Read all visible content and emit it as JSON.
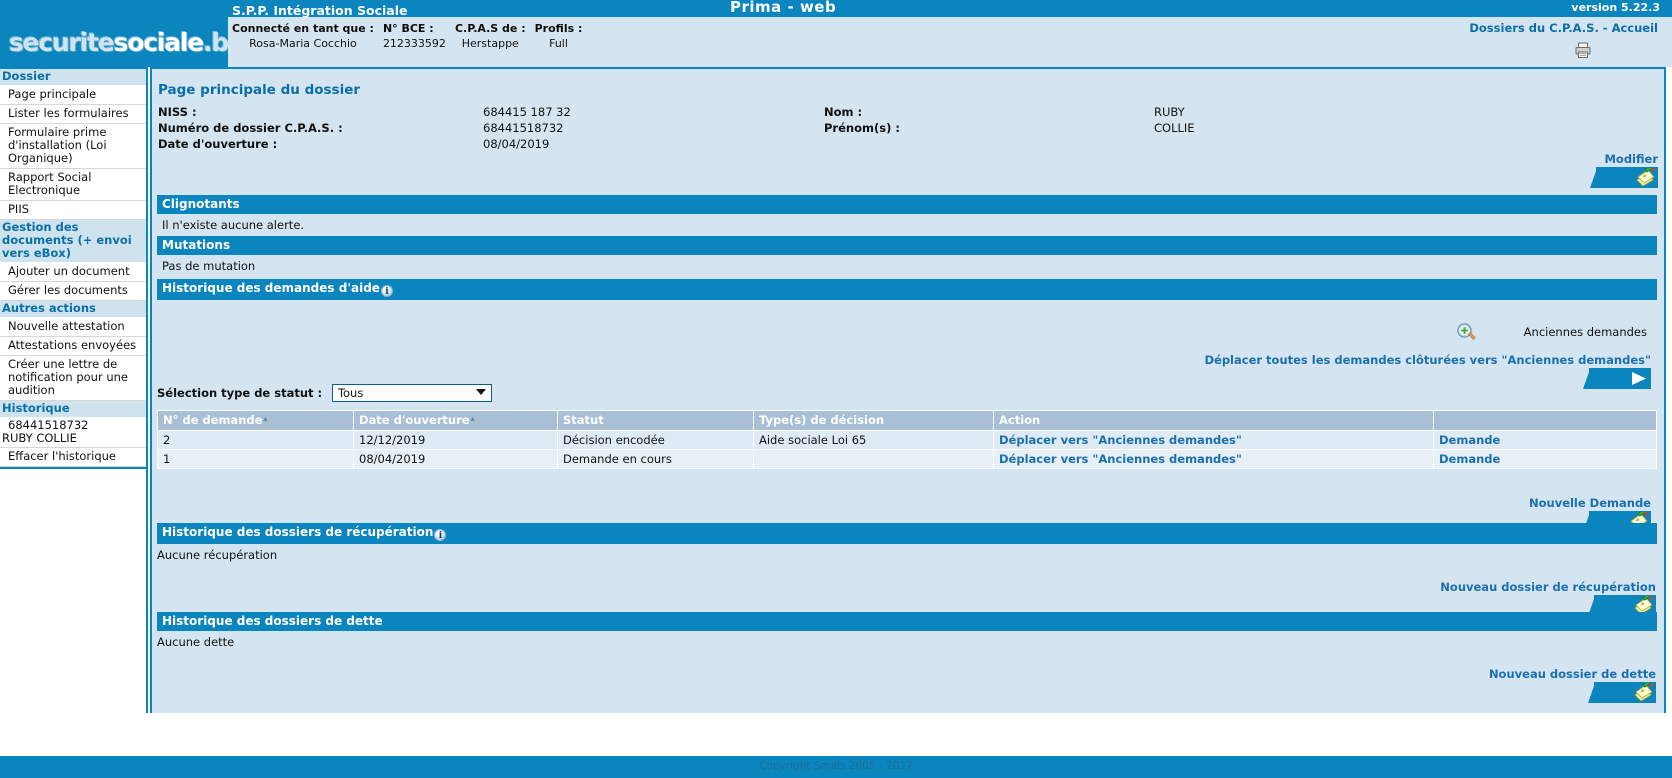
{
  "topbar": {
    "app_title": "Prima - web",
    "version": "version 5.22.3"
  },
  "header": {
    "logo_text_part1": "securite",
    "logo_text_part2": "sociale",
    "logo_text_part3": ".be",
    "spp_title": "S.P.P. Intégration Sociale",
    "fields": [
      {
        "label": "Connecté en tant que :",
        "value": "Rosa-Maria Cocchio"
      },
      {
        "label": "N° BCE :",
        "value": "212333592"
      },
      {
        "label": "C.P.A.S de :",
        "value": "Herstappe"
      },
      {
        "label": "Profils :",
        "value": "Full"
      }
    ],
    "links": "Dossiers du C.P.A.S. - Accueil",
    "printer_icon": "printer-icon"
  },
  "sidebar": {
    "groups": [
      {
        "title": "Dossier",
        "items": [
          "Page principale",
          "Lister les formulaires",
          "Formulaire prime d'installation (Loi Organique)",
          "Rapport Social Electronique",
          "PIIS"
        ]
      },
      {
        "title": "Gestion des documents (+ envoi vers eBox)",
        "items": [
          "Ajouter un document",
          "Gérer les documents"
        ]
      },
      {
        "title": "Autres actions",
        "items": [
          "Nouvelle attestation",
          "Attestations envoyées",
          "Créer une lettre de notification pour une audition"
        ]
      }
    ],
    "history": {
      "title": "Historique",
      "number": "68441518732",
      "name": "RUBY COLLIE",
      "clear_label": "Effacer l'historique"
    }
  },
  "main": {
    "page_title": "Page principale du dossier",
    "dossier": {
      "left": [
        {
          "label": "NISS :",
          "value": "684415 187 32"
        },
        {
          "label": "Numéro de dossier C.P.A.S. :",
          "value": "68441518732"
        },
        {
          "label": "Date d'ouverture :",
          "value": "08/04/2019"
        }
      ],
      "right": [
        {
          "label": "Nom :",
          "value": "RUBY"
        },
        {
          "label": "Prénom(s) :",
          "value": "COLLIE"
        }
      ],
      "modify_label": "Modifier",
      "modify_icon": "edit-pencil-icon"
    },
    "clignotants": {
      "title": "Clignotants",
      "body": "Il n'existe aucune alerte."
    },
    "mutations": {
      "title": "Mutations",
      "body": "Pas de mutation"
    },
    "aide": {
      "title": "Historique des demandes d'aide",
      "info_icon": "info-icon",
      "anciennes_label": "Anciennes demandes",
      "anciennes_icon": "magnifier-plus-icon",
      "move_all_label": "Déplacer toutes les demandes clôturées vers \"Anciennes demandes\"",
      "move_all_icon": "arrow-right-icon",
      "select_label": "Sélection type de statut :",
      "select_value": "Tous",
      "columns": [
        "N° de demande",
        "Date d'ouverture",
        "Statut",
        "Type(s) de décision",
        "Action",
        ""
      ],
      "rows": [
        {
          "numero": "2",
          "date": "12/12/2019",
          "statut": "Décision encodée",
          "type": "Aide sociale Loi 65",
          "action": "Déplacer vers \"Anciennes demandes\"",
          "link": "Demande"
        },
        {
          "numero": "1",
          "date": "08/04/2019",
          "statut": "Demande en cours",
          "type": "",
          "action": "Déplacer vers \"Anciennes demandes\"",
          "link": "Demande"
        }
      ],
      "new_label": "Nouvelle Demande",
      "new_icon": "edit-pencil-icon"
    },
    "recuperation": {
      "title": "Historique des dossiers de récupération",
      "info_icon": "info-icon",
      "body": "Aucune récupération",
      "new_label": "Nouveau dossier de récupération",
      "new_icon": "edit-pencil-icon"
    },
    "dette": {
      "title": "Historique des dossiers de dette",
      "body": "Aucune dette",
      "new_label": "Nouveau dossier de dette",
      "new_icon": "edit-pencil-icon"
    }
  },
  "footer": {
    "copyright": "Copyright Smals 2005 - 2017"
  },
  "colors": {
    "primary_blue": "#0a85bd",
    "light_blue_bg": "#d4e5f1",
    "link_blue": "#1a6fae",
    "table_header": "#a8bfd6"
  }
}
